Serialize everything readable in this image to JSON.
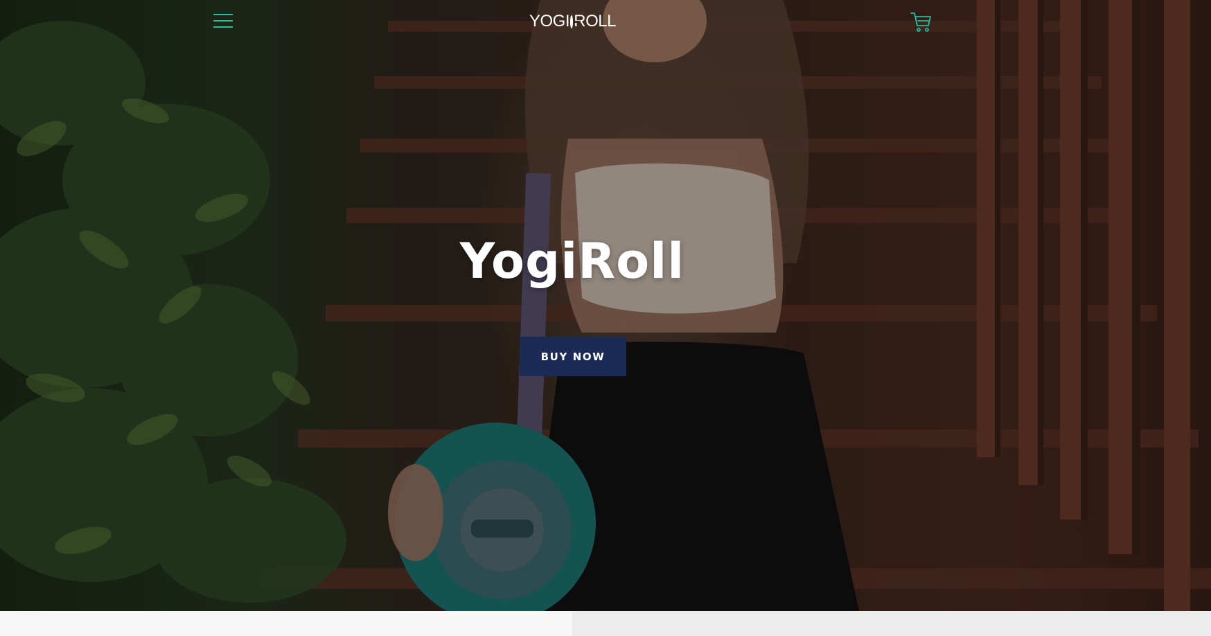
{
  "header": {
    "logo_text_left": "YOGI",
    "logo_text_right": "ROLL",
    "menu_icon": "hamburger-menu-icon",
    "cart_icon": "shopping-cart-icon",
    "accent_color": "#1fbfa0"
  },
  "hero": {
    "title": "YogiRoll",
    "cta_label": "BUY NOW",
    "cta_color": "#1b2b55",
    "photo": "woman-seated-on-stairs-holding-rolled-yoga-mat"
  }
}
